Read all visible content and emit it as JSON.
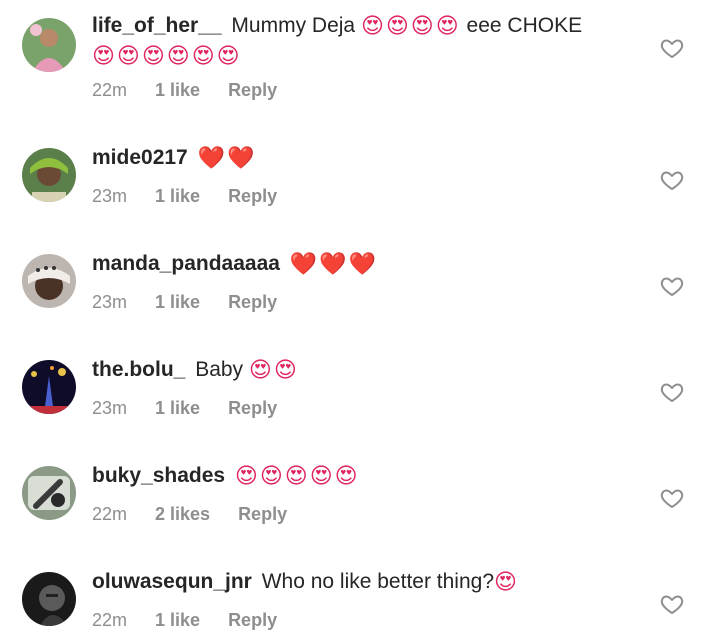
{
  "comments": [
    {
      "username": "life_of_her__",
      "text": "Mummy Deja",
      "emoji_inline": "😍😍😍😍",
      "text_after": "eee CHOKE",
      "emoji_wrap": "😍😍😍😍😍😍",
      "time": "22m",
      "likes": "1 like",
      "reply": "Reply"
    },
    {
      "username": "mide0217",
      "text": "",
      "emoji_inline": "❤️❤️",
      "text_after": "",
      "emoji_wrap": "",
      "time": "23m",
      "likes": "1 like",
      "reply": "Reply"
    },
    {
      "username": "manda_pandaaaaa",
      "text": "",
      "emoji_inline": "❤️❤️❤️",
      "text_after": "",
      "emoji_wrap": "",
      "time": "23m",
      "likes": "1 like",
      "reply": "Reply"
    },
    {
      "username": "the.bolu_",
      "text": "Baby",
      "emoji_inline": "😍😍",
      "text_after": "",
      "emoji_wrap": "",
      "time": "23m",
      "likes": "1 like",
      "reply": "Reply"
    },
    {
      "username": "buky_shades",
      "text": "",
      "emoji_inline": "😍😍😍😍😍",
      "text_after": "",
      "emoji_wrap": "",
      "time": "22m",
      "likes": "2 likes",
      "reply": "Reply"
    },
    {
      "username": "oluwasequn_jnr",
      "text": "Who no like better thing?",
      "emoji_inline": "😍",
      "text_after": "",
      "emoji_wrap": "",
      "time": "22m",
      "likes": "1 like",
      "reply": "Reply"
    }
  ],
  "colors": {
    "text": "#262626",
    "meta": "#8e8e8e",
    "heart_outline": "#8e8e8e"
  }
}
